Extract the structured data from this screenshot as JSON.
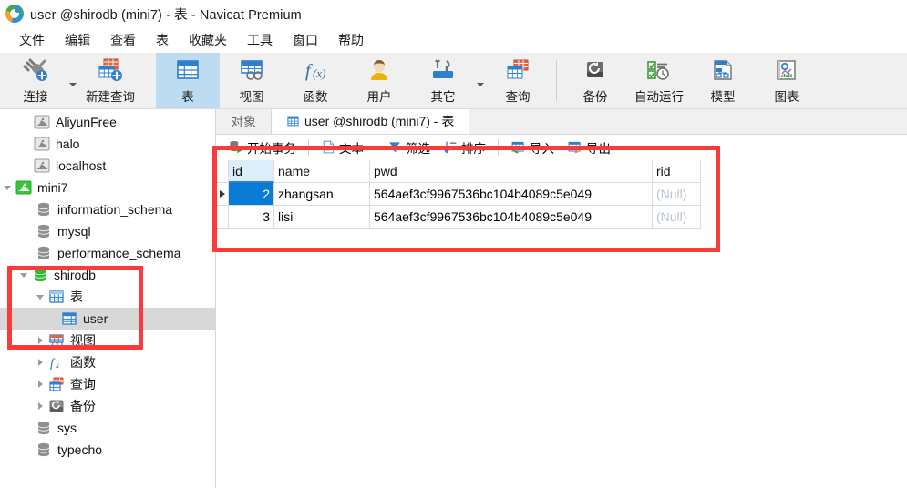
{
  "window": {
    "title": "user @shirodb (mini7) - 表 - Navicat Premium",
    "logo_icon": "navicat-logo-icon"
  },
  "menubar": {
    "items": [
      {
        "label": "文件",
        "name": "menu-file"
      },
      {
        "label": "编辑",
        "name": "menu-edit"
      },
      {
        "label": "查看",
        "name": "menu-view"
      },
      {
        "label": "表",
        "name": "menu-table"
      },
      {
        "label": "收藏夹",
        "name": "menu-favorites"
      },
      {
        "label": "工具",
        "name": "menu-tools"
      },
      {
        "label": "窗口",
        "name": "menu-window"
      },
      {
        "label": "帮助",
        "name": "menu-help"
      }
    ]
  },
  "toolbar": {
    "buttons": [
      {
        "label": "连接",
        "icon": "connection-plug-icon",
        "has_caret": true,
        "active": false
      },
      {
        "label": "新建查询",
        "icon": "new-query-icon",
        "has_caret": false,
        "active": false
      },
      {
        "label": "表",
        "icon": "table-icon",
        "has_caret": false,
        "active": true
      },
      {
        "label": "视图",
        "icon": "view-icon",
        "has_caret": false,
        "active": false
      },
      {
        "label": "函数",
        "icon": "function-fx-icon",
        "has_caret": false,
        "active": false
      },
      {
        "label": "用户",
        "icon": "user-icon",
        "has_caret": false,
        "active": false
      },
      {
        "label": "其它",
        "icon": "other-tools-icon",
        "has_caret": true,
        "active": false
      },
      {
        "label": "查询",
        "icon": "query-icon",
        "has_caret": false,
        "active": false
      },
      {
        "label": "备份",
        "icon": "backup-icon",
        "has_caret": false,
        "active": false
      },
      {
        "label": "自动运行",
        "icon": "automation-icon",
        "has_caret": false,
        "active": false
      },
      {
        "label": "模型",
        "icon": "model-icon",
        "has_caret": false,
        "active": false
      },
      {
        "label": "图表",
        "icon": "chart-icon",
        "has_caret": false,
        "active": false
      }
    ]
  },
  "sidebar": {
    "items": [
      {
        "label": "AliyunFree",
        "icon": "connection-icon",
        "indent": 1,
        "twisty": "none",
        "state": "disconnected",
        "selected": false
      },
      {
        "label": "halo",
        "icon": "connection-icon",
        "indent": 1,
        "twisty": "none",
        "state": "disconnected",
        "selected": false
      },
      {
        "label": "localhost",
        "icon": "connection-icon",
        "indent": 1,
        "twisty": "none",
        "state": "disconnected",
        "selected": false
      },
      {
        "label": "mini7",
        "icon": "connection-icon",
        "indent": 0,
        "twisty": "open",
        "state": "connected",
        "selected": false
      },
      {
        "label": "information_schema",
        "icon": "database-icon",
        "indent": 2,
        "twisty": "none",
        "state": "closed",
        "selected": false
      },
      {
        "label": "mysql",
        "icon": "database-icon",
        "indent": 2,
        "twisty": "none",
        "state": "closed",
        "selected": false
      },
      {
        "label": "performance_schema",
        "icon": "database-icon",
        "indent": 2,
        "twisty": "none",
        "state": "closed",
        "selected": false
      },
      {
        "label": "shirodb",
        "icon": "database-icon",
        "indent": 1,
        "twisty": "open",
        "state": "open",
        "selected": false
      },
      {
        "label": "表",
        "icon": "table-folder-icon",
        "indent": 2,
        "twisty": "open",
        "state": "open",
        "selected": false
      },
      {
        "label": "user",
        "icon": "table-icon",
        "indent": 4,
        "twisty": "none",
        "state": "none",
        "selected": true
      },
      {
        "label": "视图",
        "icon": "view-folder-icon",
        "indent": 2,
        "twisty": "closed",
        "state": "closed",
        "selected": false
      },
      {
        "label": "函数",
        "icon": "function-folder-icon",
        "indent": 2,
        "twisty": "closed",
        "state": "closed",
        "selected": false
      },
      {
        "label": "查询",
        "icon": "query-folder-icon",
        "indent": 2,
        "twisty": "closed",
        "state": "closed",
        "selected": false
      },
      {
        "label": "备份",
        "icon": "backup-folder-icon",
        "indent": 2,
        "twisty": "closed",
        "state": "closed",
        "selected": false
      },
      {
        "label": "sys",
        "icon": "database-icon",
        "indent": 2,
        "twisty": "none",
        "state": "closed",
        "selected": false
      },
      {
        "label": "typecho",
        "icon": "database-icon",
        "indent": 2,
        "twisty": "none",
        "state": "closed",
        "selected": false
      }
    ]
  },
  "tabs": [
    {
      "label": "对象",
      "name": "tab-objects",
      "active": false,
      "icon": null
    },
    {
      "label": "user @shirodb (mini7) - 表",
      "name": "tab-user-table",
      "active": true,
      "icon": "table-icon"
    }
  ],
  "grid_toolbar": {
    "buttons": [
      {
        "label": "开始事务",
        "icon": "begin-transaction-icon",
        "caret": false
      },
      {
        "label": "文本",
        "icon": "text-icon",
        "caret": true
      },
      {
        "label": "筛选",
        "icon": "filter-icon",
        "caret": false
      },
      {
        "label": "排序",
        "icon": "sort-icon",
        "caret": false
      },
      {
        "label": "导入",
        "icon": "import-icon",
        "caret": false
      },
      {
        "label": "导出",
        "icon": "export-icon",
        "caret": false
      }
    ]
  },
  "grid": {
    "columns": [
      "id",
      "name",
      "pwd",
      "rid"
    ],
    "active_column": "id",
    "rows": [
      {
        "marker": true,
        "id": "2",
        "name": "zhangsan",
        "pwd": "564aef3cf9967536bc104b4089c5e049",
        "rid": "(Null)",
        "selected_cell": "id"
      },
      {
        "marker": false,
        "id": "3",
        "name": "lisi",
        "pwd": "564aef3cf9967536bc104b4089c5e049",
        "rid": "(Null)",
        "selected_cell": null
      }
    ]
  },
  "annotations": [
    {
      "name": "annotation-box-grid",
      "color": "#fb3b3b"
    },
    {
      "name": "annotation-box-tree",
      "color": "#fb3b3b"
    }
  ]
}
